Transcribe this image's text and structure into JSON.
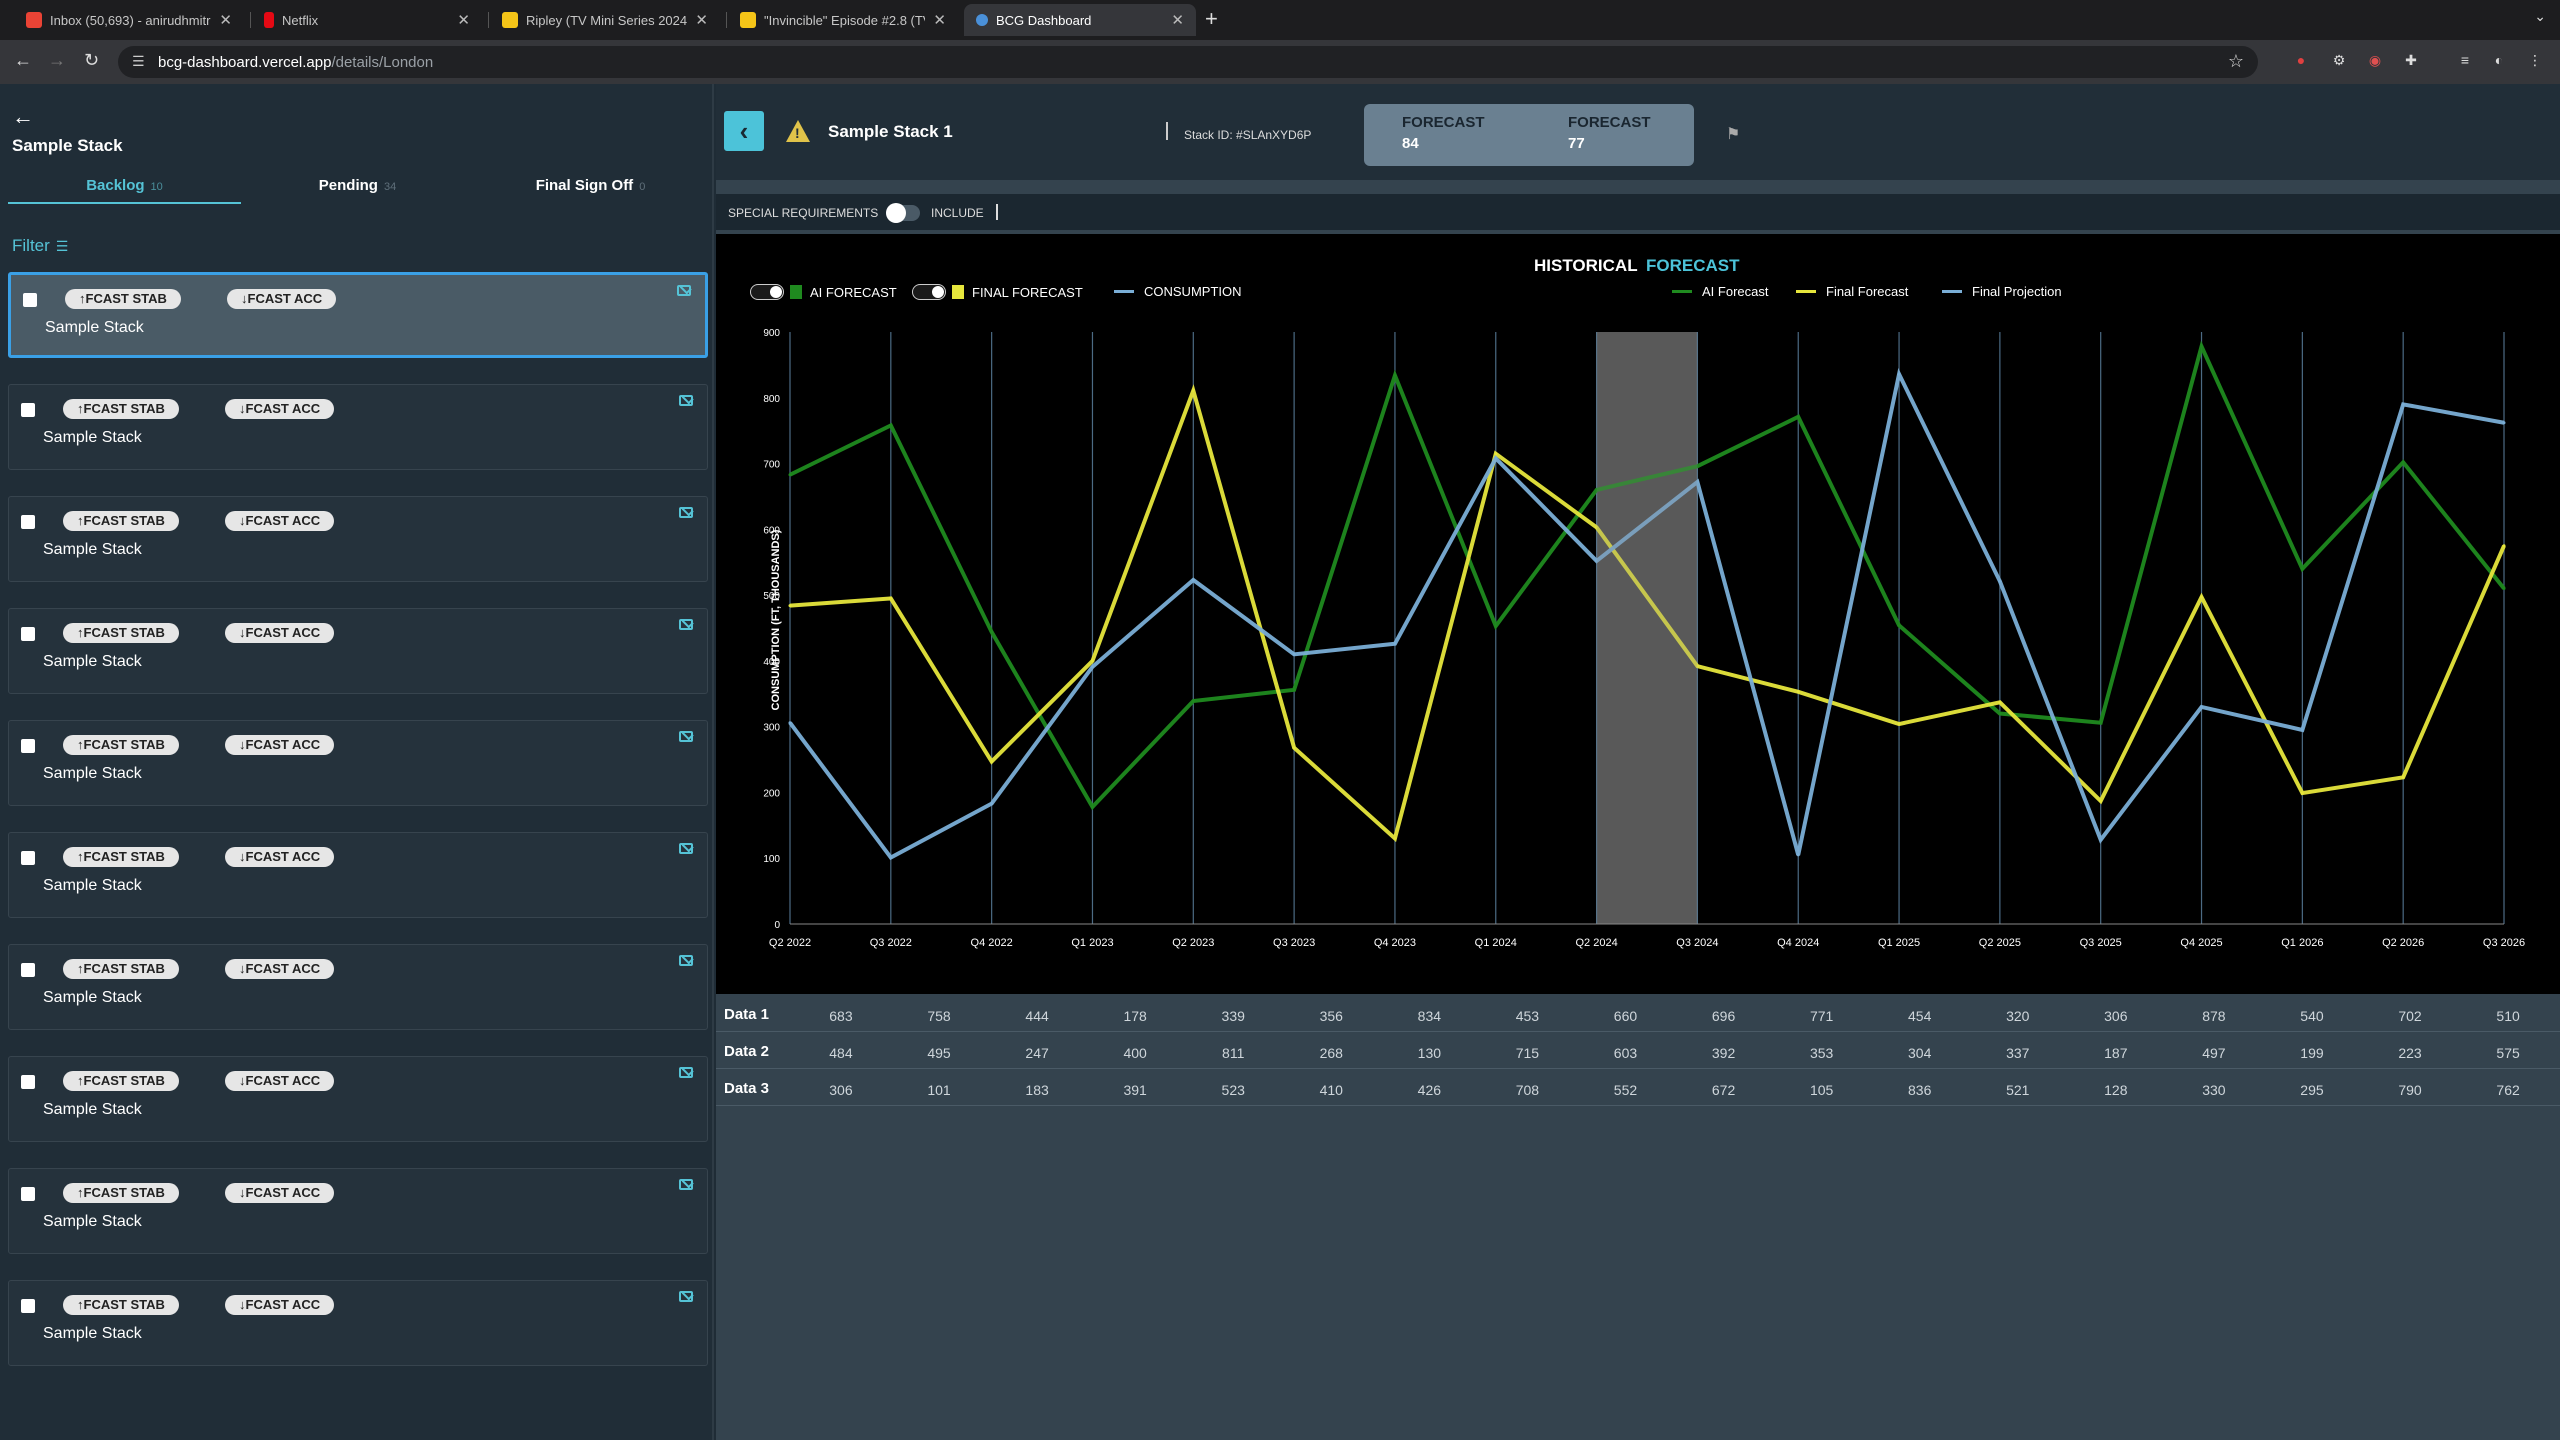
{
  "browser": {
    "tabs": [
      {
        "title": "Inbox (50,693) - anirudhmitr",
        "favicon_color": "#ea4335",
        "active": false
      },
      {
        "title": "Netflix",
        "favicon_color": "#e50914",
        "active": false
      },
      {
        "title": "Ripley (TV Mini Series 2024)",
        "favicon_color": "#f5c518",
        "active": false
      },
      {
        "title": "\"Invincible\" Episode #2.8 (TV",
        "favicon_color": "#f5c518",
        "active": false
      },
      {
        "title": "BCG Dashboard",
        "favicon_color": "#4a90d9",
        "active": true
      }
    ],
    "url_host": "bcg-dashboard.vercel.app",
    "url_path": "/details/London"
  },
  "sidebar": {
    "title": "Sample Stack",
    "tabs": [
      {
        "label": "Backlog",
        "count": "10"
      },
      {
        "label": "Pending",
        "count": "34"
      },
      {
        "label": "Final Sign Off",
        "count": "0"
      }
    ],
    "filter_label": "Filter",
    "stab_label": "↑FCAST STAB",
    "acc_label": "↓FCAST ACC",
    "cards": [
      {
        "name": "Sample Stack"
      },
      {
        "name": "Sample Stack"
      },
      {
        "name": "Sample Stack"
      },
      {
        "name": "Sample Stack"
      },
      {
        "name": "Sample Stack"
      },
      {
        "name": "Sample Stack"
      },
      {
        "name": "Sample Stack"
      },
      {
        "name": "Sample Stack"
      },
      {
        "name": "Sample Stack"
      },
      {
        "name": "Sample Stack"
      }
    ]
  },
  "header": {
    "title": "Sample Stack 1",
    "stack_id": "Stack ID: #SLAnXYD6P",
    "forecasts": [
      {
        "label": "FORECAST",
        "value": "84"
      },
      {
        "label": "FORECAST",
        "value": "77"
      }
    ]
  },
  "special": {
    "label": "SPECIAL REQUIREMENTS",
    "include_label": "INCLUDE"
  },
  "chart_toggle": {
    "historical": "HISTORICAL",
    "forecast": "FORECAST"
  },
  "legend": {
    "ai_forecast": "AI FORECAST",
    "final_forecast": "FINAL FORECAST",
    "consumption": "CONSUMPTION",
    "ai_forecast_line": "AI Forecast",
    "final_forecast_line": "Final Forecast",
    "final_projection": "Final Projection"
  },
  "colors": {
    "green": "#1f8a1f",
    "yellow": "#e6e63c",
    "blue": "#7aaed6",
    "accent": "#4cc3d9"
  },
  "chart_data": {
    "type": "line",
    "ylabel": "CONSUMPTION (FT, THOUSANDS)",
    "ylim": [
      0,
      900
    ],
    "yticks": [
      0,
      100,
      200,
      300,
      400,
      500,
      600,
      700,
      800,
      900
    ],
    "highlight_band": [
      "Q2 2024",
      "Q3 2024"
    ],
    "categories": [
      "Q2 2022",
      "Q3 2022",
      "Q4 2022",
      "Q1 2023",
      "Q2 2023",
      "Q3 2023",
      "Q4 2023",
      "Q1 2024",
      "Q2 2024",
      "Q3 2024",
      "Q4 2024",
      "Q1 2025",
      "Q2 2025",
      "Q3 2025",
      "Q4 2025",
      "Q1 2026",
      "Q2 2026",
      "Q3 2026"
    ],
    "series": [
      {
        "name": "Data 1",
        "color": "#1f8a1f",
        "values": [
          683,
          758,
          444,
          178,
          339,
          356,
          834,
          453,
          660,
          696,
          771,
          454,
          320,
          306,
          878,
          540,
          702,
          510
        ]
      },
      {
        "name": "Data 2",
        "color": "#e6e63c",
        "values": [
          484,
          495,
          247,
          400,
          811,
          268,
          130,
          715,
          603,
          392,
          353,
          304,
          337,
          187,
          497,
          199,
          223,
          575
        ]
      },
      {
        "name": "Data 3",
        "color": "#7aaed6",
        "values": [
          306,
          101,
          183,
          391,
          523,
          410,
          426,
          708,
          552,
          672,
          105,
          836,
          521,
          128,
          330,
          295,
          790,
          762
        ]
      }
    ]
  }
}
